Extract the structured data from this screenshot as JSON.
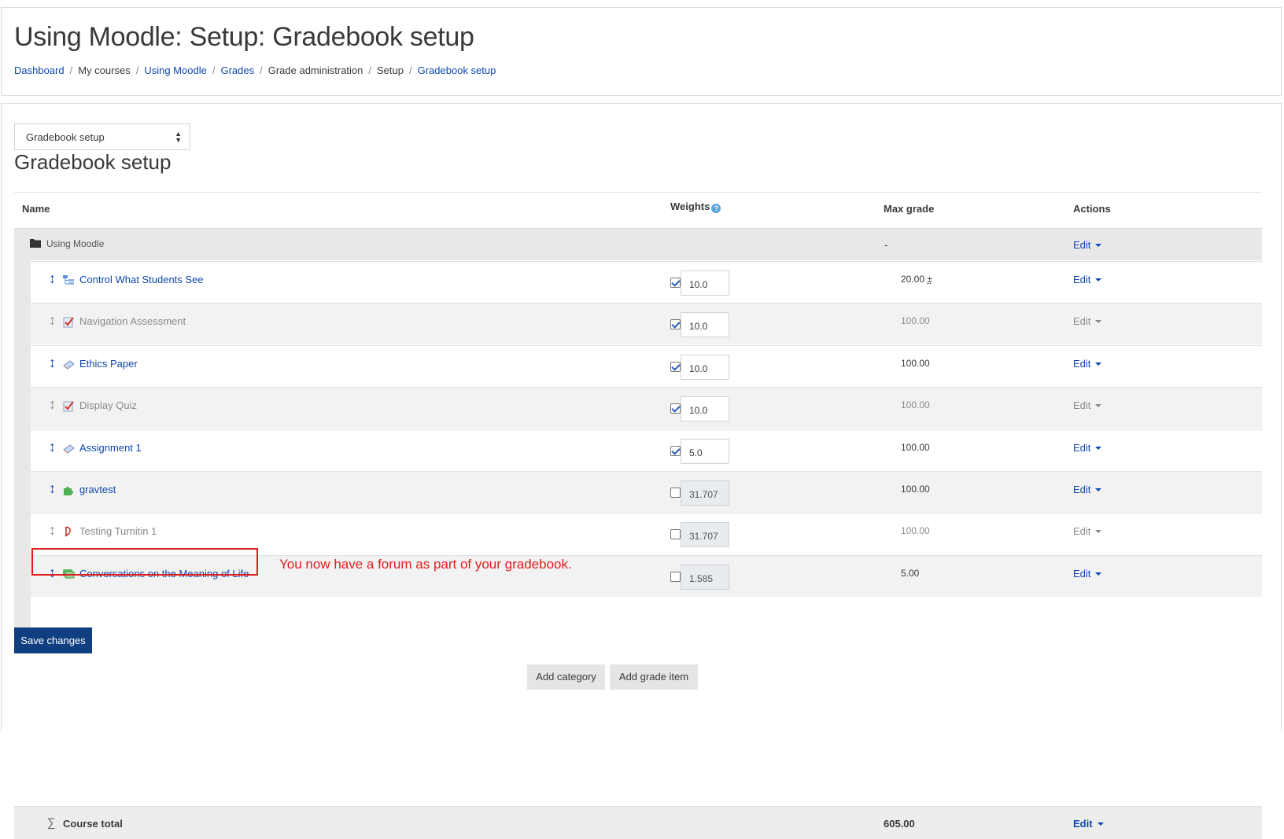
{
  "header": {
    "title": "Using Moodle: Setup: Gradebook setup",
    "breadcrumb": [
      {
        "label": "Dashboard",
        "link": true
      },
      {
        "label": "My courses",
        "link": false
      },
      {
        "label": "Using Moodle",
        "link": true
      },
      {
        "label": "Grades",
        "link": true
      },
      {
        "label": "Grade administration",
        "link": false
      },
      {
        "label": "Setup",
        "link": false
      },
      {
        "label": "Gradebook setup",
        "link": true
      }
    ]
  },
  "nav_select": {
    "value": "Gradebook setup"
  },
  "section_title": "Gradebook setup",
  "table": {
    "headers": {
      "name": "Name",
      "weights": "Weights",
      "max_grade": "Max grade",
      "actions": "Actions"
    },
    "help_icon": "?",
    "category": {
      "name": "Using Moodle",
      "max_grade": "-",
      "action": "Edit",
      "icon": "folder-icon"
    },
    "items": [
      {
        "name": "Control What Students See",
        "icon": "category-tree-icon",
        "visible": true,
        "weight_checked": true,
        "weight": "10.0",
        "max_grade": "20.00",
        "max_suffix": "±",
        "action": "Edit"
      },
      {
        "name": "Navigation Assessment",
        "icon": "quiz-icon",
        "visible": false,
        "weight_checked": true,
        "weight": "10.0",
        "max_grade": "100.00",
        "max_suffix": "",
        "action": "Edit"
      },
      {
        "name": "Ethics Paper",
        "icon": "assignment-icon",
        "visible": true,
        "weight_checked": true,
        "weight": "10.0",
        "max_grade": "100.00",
        "max_suffix": "",
        "action": "Edit"
      },
      {
        "name": "Display Quiz",
        "icon": "quiz-icon",
        "visible": false,
        "weight_checked": true,
        "weight": "10.0",
        "max_grade": "100.00",
        "max_suffix": "",
        "action": "Edit"
      },
      {
        "name": "Assignment 1",
        "icon": "assignment-icon",
        "visible": true,
        "weight_checked": true,
        "weight": "5.0",
        "max_grade": "100.00",
        "max_suffix": "",
        "action": "Edit"
      },
      {
        "name": "gravtest",
        "icon": "puzzle-icon",
        "visible": true,
        "weight_checked": false,
        "weight": "31.707",
        "max_grade": "100.00",
        "max_suffix": "",
        "action": "Edit"
      },
      {
        "name": "Testing Turnitin 1",
        "icon": "turnitin-icon",
        "visible": false,
        "weight_checked": false,
        "weight": "31.707",
        "max_grade": "100.00",
        "max_suffix": "",
        "action": "Edit"
      },
      {
        "name": "Conversations on the Meaning of Life",
        "icon": "forum-icon",
        "visible": true,
        "weight_checked": false,
        "weight": "1.585",
        "max_grade": "5.00",
        "max_suffix": "",
        "action": "Edit"
      }
    ],
    "total": {
      "label": "Course total",
      "max_grade": "605.00",
      "action": "Edit",
      "icon": "sigma-icon"
    }
  },
  "annotation": "You now have a forum as part of your gradebook.",
  "buttons": {
    "save": "Save changes",
    "add_category": "Add category",
    "add_grade_item": "Add grade item"
  },
  "colors": {
    "link": "#0f47ad",
    "annotation": "#e11e1e",
    "primary_button": "#0f3f80"
  }
}
